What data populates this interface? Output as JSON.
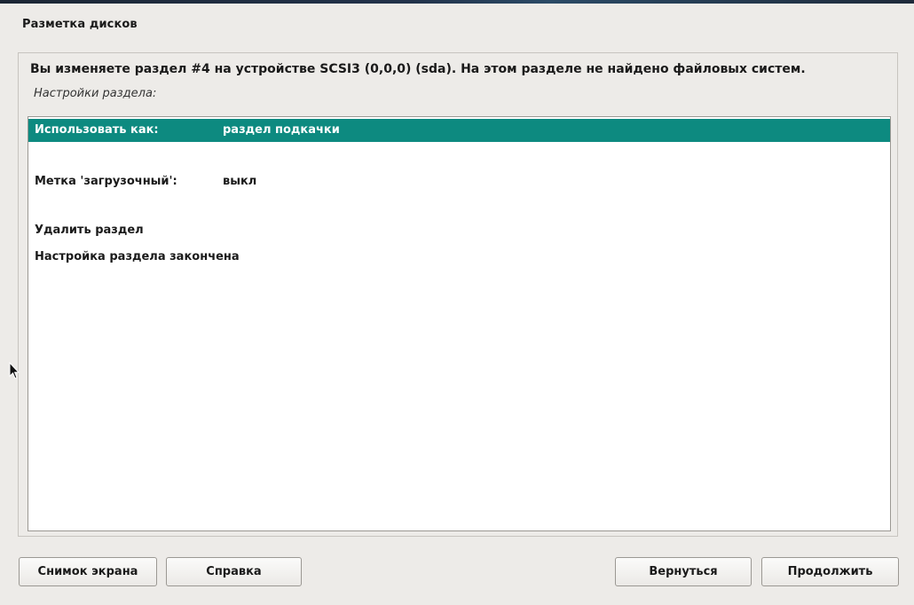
{
  "header": {
    "title": "Разметка дисков"
  },
  "dialog": {
    "question": "Вы изменяете раздел #4 на устройстве SCSI3 (0,0,0) (sda). На этом разделе не найдено файловых систем.",
    "subtitle": "Настройки раздела:"
  },
  "options": [
    {
      "key": "Использовать как:",
      "value": "раздел подкачки",
      "selected": true
    },
    {
      "key": "",
      "value": "",
      "selected": false
    },
    {
      "key": "Метка 'загрузочный':",
      "value": "выкл",
      "selected": false
    },
    {
      "key": "",
      "value": "",
      "selected": false
    },
    {
      "key": "Удалить раздел",
      "value": "",
      "selected": false
    },
    {
      "key": "Настройка раздела закончена",
      "value": "",
      "selected": false
    }
  ],
  "buttons": {
    "screenshot": "Снимок экрана",
    "help": "Справка",
    "back": "Вернуться",
    "continue": "Продолжить"
  },
  "colors": {
    "selection": "#0d8a80",
    "background": "#edebe8"
  },
  "icons": {
    "cursor": "mouse-pointer-icon"
  }
}
